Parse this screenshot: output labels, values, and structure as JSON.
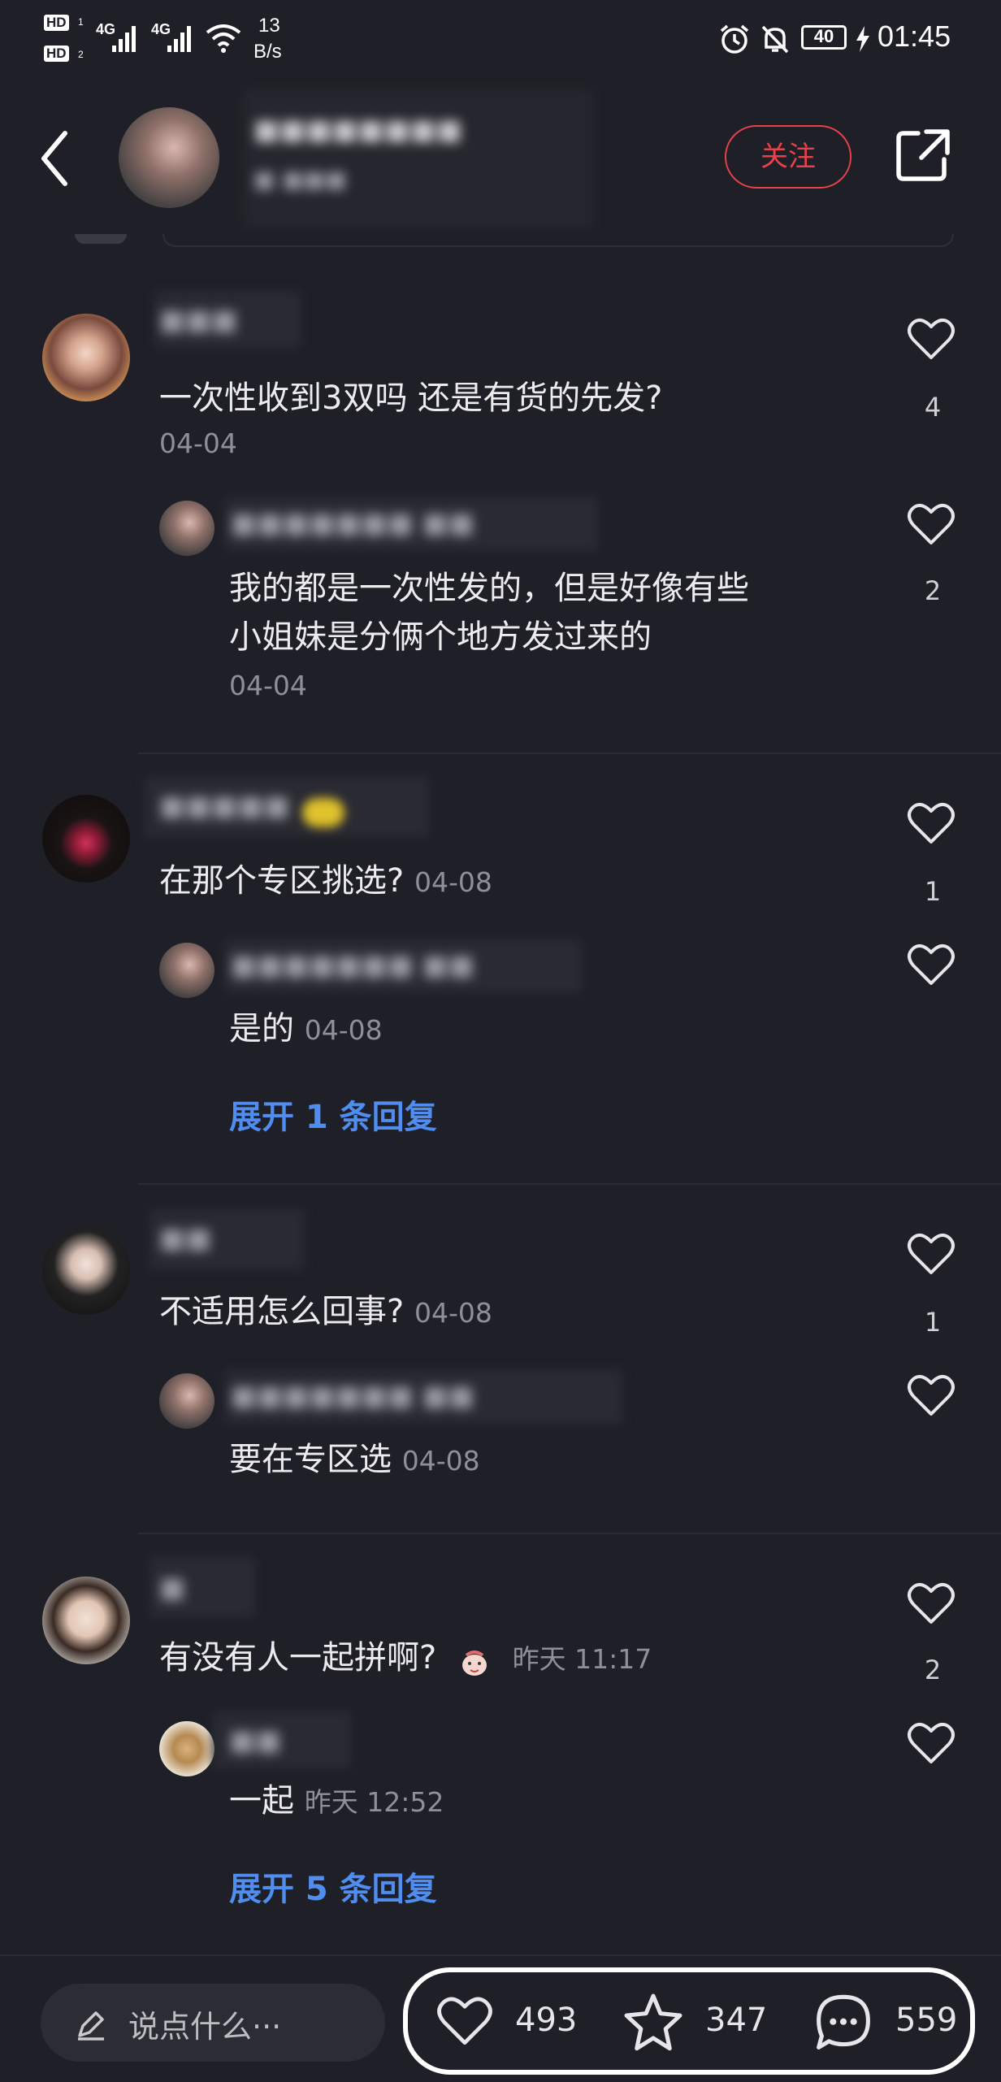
{
  "status": {
    "net_speed_value": "13",
    "net_speed_unit": "B/s",
    "battery": "40",
    "time": "01:45",
    "hd1": "HD",
    "hd2": "HD",
    "sig1": "4G",
    "sig2": "4G"
  },
  "header": {
    "follow_label": "关注"
  },
  "comments": [
    {
      "text": "一次性收到3双吗  还是有货的先发?",
      "date": "04-04",
      "likes": "4",
      "reply": {
        "line1": "我的都是一次性发的，但是好像有些",
        "line2": "小姐妹是分俩个地方发过来的",
        "date": "04-04",
        "likes": "2"
      }
    },
    {
      "text": "在那个专区挑选?",
      "date": "04-08",
      "likes": "1",
      "reply": {
        "text": "是的",
        "date": "04-08"
      },
      "expand": "展开 1 条回复"
    },
    {
      "text": "不适用怎么回事?",
      "date": "04-08",
      "likes": "1",
      "reply": {
        "text": "要在专区选",
        "date": "04-08"
      }
    },
    {
      "text": "有没有人一起拼啊?",
      "date": "昨天 11:17",
      "likes": "2",
      "reply": {
        "text": "一起",
        "date": "昨天 12:52"
      },
      "expand": "展开 5 条回复"
    }
  ],
  "bottom": {
    "input_placeholder": "说点什么···",
    "likes": "493",
    "favorites": "347",
    "comments": "559"
  },
  "colors": {
    "background": "#1f1f27",
    "accent_red": "#e8414a",
    "link_blue": "#4f8ef0"
  }
}
